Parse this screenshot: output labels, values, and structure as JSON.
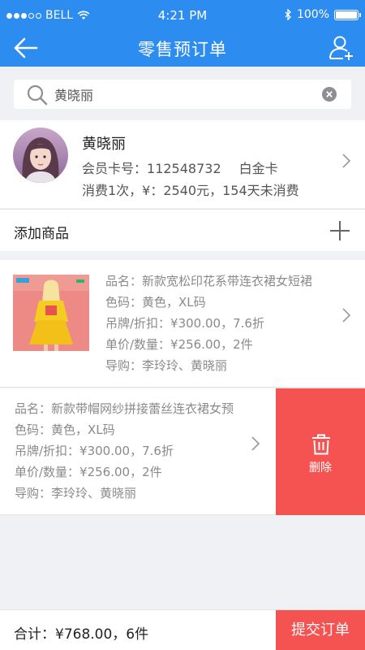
{
  "status_bar": {
    "carrier": "BELL",
    "time": "4:21 PM",
    "battery": "100%",
    "icons": [
      "signal-dots",
      "wifi-icon",
      "bluetooth-icon",
      "battery-icon"
    ]
  },
  "nav": {
    "title": "零售预订单",
    "left_icon": "back-arrow-icon",
    "right_icon": "add-user-icon"
  },
  "search": {
    "value": "黄晓丽",
    "placeholder": "",
    "icon": "search-icon",
    "clear_icon": "clear-icon"
  },
  "member": {
    "name": "黄晓丽",
    "card_label": "会员卡号：",
    "card_number": "112548732",
    "tier": "白金卡",
    "summary": "消费1次，¥：2540元，154天未消费"
  },
  "add_product": {
    "label": "添加商品",
    "icon": "plus-icon"
  },
  "products": [
    {
      "name": "品名：新款宽松印花系带连衣裙女短裙",
      "color_size": "色码：黄色，XL码",
      "tag_discount": "吊牌/折扣：¥300.00，7.6折",
      "price_qty": "单价/数量：¥256.00，2件",
      "guide": "导购：李玲玲、黄晓丽"
    },
    {
      "name": "品名：新款带帽网纱拼接蕾丝连衣裙女预",
      "color_size": "色码：黄色，XL码",
      "tag_discount": "吊牌/折扣：¥300.00，7.6折",
      "price_qty": "单价/数量：¥256.00，2件",
      "guide": "导购：李玲玲、黄晓丽"
    }
  ],
  "delete_action": {
    "label": "删除",
    "icon": "trash-icon"
  },
  "footer": {
    "total": "合计：¥768.00，6件",
    "submit": "提交订单"
  },
  "colors": {
    "primary": "#2d8cf0",
    "danger": "#f55252",
    "background": "#f0f1f5",
    "muted_text": "#8a8a8a"
  }
}
